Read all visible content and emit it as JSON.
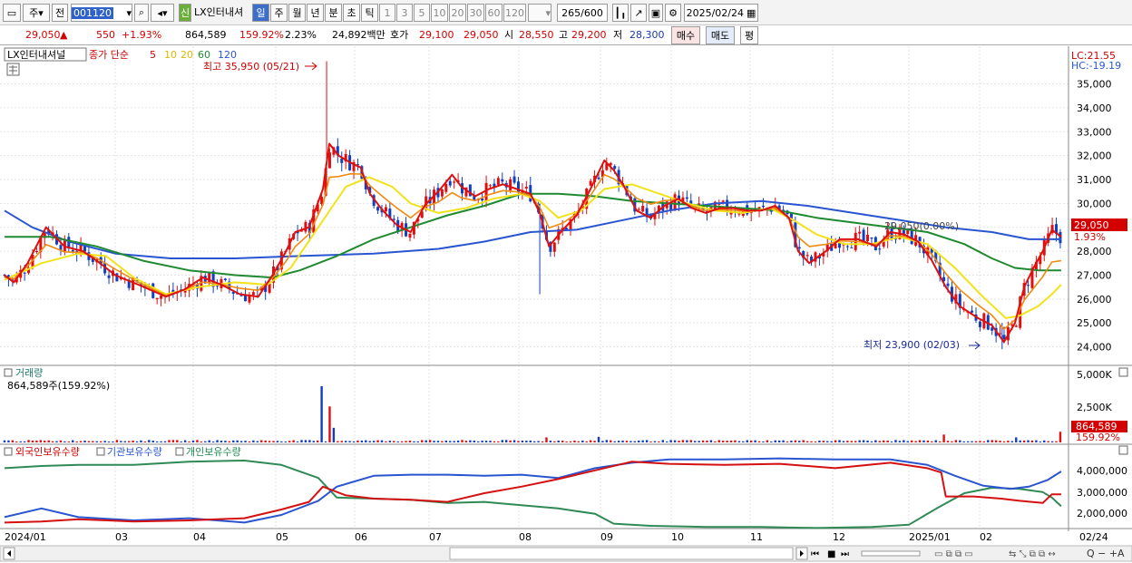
{
  "toolbar": {
    "mode": "주",
    "prev": "전",
    "code": "001120",
    "name": "LX인터내셔",
    "credit_badge": "신",
    "periods": [
      "일",
      "주",
      "월",
      "년",
      "분",
      "초",
      "틱"
    ],
    "numbers": [
      "1",
      "3",
      "5",
      "10",
      "20",
      "30",
      "60",
      "120"
    ],
    "count": "265",
    "count_total": "/600",
    "date": "2025/02/24"
  },
  "quote": {
    "price": "29,050",
    "arrow": "▲",
    "change": "550",
    "pct": "+1.93%",
    "volume": "864,589",
    "vol_ratio": "159.92%",
    "turnover_rate": "2.23%",
    "amount": "24,892백만",
    "ask_label": "호가",
    "ask": "29,100",
    "bid": "29,050",
    "open_label": "시",
    "open": "28,550",
    "high_label": "고",
    "high": "29,200",
    "low_label": "저",
    "low": "28,300",
    "buy": "매수",
    "sell": "매도",
    "avg": "평"
  },
  "legend": {
    "name": "LX인터내셔널",
    "ma_label": "종가 단순",
    "ma5": "5",
    "ma10": "10",
    "ma20": "20",
    "ma60": "60",
    "ma120": "120"
  },
  "annotations": {
    "high": "최고 35,950 (05/21)",
    "low": "최저 23,900 (02/03)",
    "mid": "29,050(0.00%)",
    "lc": "LC:21.55",
    "hc": "HC:-19.19",
    "last_price": "29,050",
    "last_pct": "1.93%"
  },
  "volume_panel": {
    "title": "거래량",
    "value": "864,589주(159.92%)",
    "last": "864,589",
    "last_pct": "159.92%",
    "ticks": [
      "5,000K",
      "2,500K"
    ]
  },
  "holdings_panel": {
    "series": [
      "외국인보유수량",
      "기관보유수량",
      "개인보유수량"
    ],
    "ticks": [
      "4,000,000",
      "3,000,000",
      "2,000,000"
    ]
  },
  "xaxis": [
    "2024/01",
    "03",
    "04",
    "05",
    "06",
    "07",
    "08",
    "09",
    "10",
    "11",
    "12",
    "2025/01",
    "02",
    "02/24"
  ],
  "chart_data": {
    "type": "candlestick",
    "ylim": [
      23300,
      36500
    ],
    "yticks": [
      35000,
      34000,
      33000,
      32000,
      31000,
      30000,
      29000,
      28000,
      27000,
      26000,
      25000,
      24000
    ],
    "high": {
      "value": 35950,
      "date": "05/21"
    },
    "low": {
      "value": 23900,
      "date": "02/03"
    },
    "last": 29050,
    "ma5": [
      [
        0,
        27000
      ],
      [
        10,
        26700
      ],
      [
        25,
        27500
      ],
      [
        45,
        29000
      ],
      [
        65,
        28200
      ],
      [
        85,
        28000
      ],
      [
        100,
        27600
      ],
      [
        120,
        27000
      ],
      [
        145,
        26600
      ],
      [
        175,
        26100
      ],
      [
        195,
        26400
      ],
      [
        215,
        26900
      ],
      [
        235,
        26600
      ],
      [
        255,
        26200
      ],
      [
        275,
        26100
      ],
      [
        292,
        27100
      ],
      [
        305,
        28000
      ],
      [
        315,
        28800
      ],
      [
        330,
        29000
      ],
      [
        345,
        30600
      ],
      [
        352,
        32500
      ],
      [
        362,
        32000
      ],
      [
        375,
        31700
      ],
      [
        386,
        31500
      ],
      [
        396,
        30400
      ],
      [
        410,
        29700
      ],
      [
        425,
        29100
      ],
      [
        440,
        28800
      ],
      [
        455,
        29900
      ],
      [
        470,
        30500
      ],
      [
        485,
        31200
      ],
      [
        495,
        30700
      ],
      [
        510,
        30300
      ],
      [
        525,
        30600
      ],
      [
        540,
        30800
      ],
      [
        555,
        30600
      ],
      [
        570,
        30400
      ],
      [
        580,
        29600
      ],
      [
        590,
        28200
      ],
      [
        605,
        28900
      ],
      [
        620,
        29500
      ],
      [
        635,
        30600
      ],
      [
        650,
        31800
      ],
      [
        660,
        31400
      ],
      [
        670,
        30800
      ],
      [
        685,
        29700
      ],
      [
        700,
        29400
      ],
      [
        715,
        29900
      ],
      [
        730,
        30200
      ],
      [
        745,
        29800
      ],
      [
        760,
        29600
      ],
      [
        775,
        29800
      ],
      [
        790,
        29800
      ],
      [
        805,
        29700
      ],
      [
        820,
        29700
      ],
      [
        835,
        29900
      ],
      [
        850,
        29400
      ],
      [
        860,
        28000
      ],
      [
        872,
        27500
      ],
      [
        890,
        28000
      ],
      [
        905,
        28500
      ],
      [
        925,
        28500
      ],
      [
        945,
        28200
      ],
      [
        960,
        28800
      ],
      [
        975,
        28700
      ],
      [
        990,
        28400
      ],
      [
        1005,
        27600
      ],
      [
        1020,
        26500
      ],
      [
        1035,
        25700
      ],
      [
        1055,
        25200
      ],
      [
        1070,
        24900
      ],
      [
        1083,
        24200
      ],
      [
        1095,
        25000
      ],
      [
        1105,
        26500
      ],
      [
        1115,
        27300
      ],
      [
        1125,
        28000
      ],
      [
        1135,
        28900
      ],
      [
        1145,
        28600
      ]
    ],
    "ma20": [
      [
        0,
        26800
      ],
      [
        40,
        27500
      ],
      [
        80,
        27900
      ],
      [
        110,
        27800
      ],
      [
        140,
        26900
      ],
      [
        175,
        26200
      ],
      [
        210,
        26500
      ],
      [
        250,
        26700
      ],
      [
        285,
        26600
      ],
      [
        310,
        27300
      ],
      [
        340,
        29000
      ],
      [
        370,
        30700
      ],
      [
        395,
        31100
      ],
      [
        420,
        30700
      ],
      [
        440,
        30000
      ],
      [
        470,
        29600
      ],
      [
        500,
        29800
      ],
      [
        530,
        30200
      ],
      [
        560,
        30400
      ],
      [
        580,
        30100
      ],
      [
        600,
        29400
      ],
      [
        625,
        29700
      ],
      [
        650,
        30600
      ],
      [
        680,
        30800
      ],
      [
        710,
        30400
      ],
      [
        740,
        30000
      ],
      [
        770,
        29700
      ],
      [
        800,
        29600
      ],
      [
        830,
        29800
      ],
      [
        855,
        29300
      ],
      [
        880,
        28700
      ],
      [
        910,
        28300
      ],
      [
        940,
        28300
      ],
      [
        970,
        28600
      ],
      [
        1000,
        28300
      ],
      [
        1030,
        27300
      ],
      [
        1060,
        26100
      ],
      [
        1085,
        25200
      ],
      [
        1100,
        25300
      ],
      [
        1120,
        25700
      ],
      [
        1135,
        26200
      ],
      [
        1145,
        26600
      ]
    ],
    "ma60": [
      [
        0,
        28600
      ],
      [
        50,
        28600
      ],
      [
        100,
        28200
      ],
      [
        150,
        27600
      ],
      [
        200,
        27200
      ],
      [
        250,
        27000
      ],
      [
        290,
        26900
      ],
      [
        320,
        27200
      ],
      [
        360,
        27800
      ],
      [
        400,
        28500
      ],
      [
        440,
        29000
      ],
      [
        480,
        29500
      ],
      [
        520,
        29900
      ],
      [
        560,
        30400
      ],
      [
        600,
        30400
      ],
      [
        640,
        30300
      ],
      [
        680,
        30100
      ],
      [
        720,
        30000
      ],
      [
        760,
        29900
      ],
      [
        800,
        29800
      ],
      [
        840,
        29700
      ],
      [
        880,
        29400
      ],
      [
        920,
        29200
      ],
      [
        960,
        29000
      ],
      [
        1000,
        28800
      ],
      [
        1040,
        28300
      ],
      [
        1070,
        27700
      ],
      [
        1095,
        27300
      ],
      [
        1120,
        27200
      ],
      [
        1145,
        27200
      ]
    ],
    "ma120": [
      [
        0,
        29700
      ],
      [
        30,
        29000
      ],
      [
        70,
        28400
      ],
      [
        120,
        27900
      ],
      [
        180,
        27700
      ],
      [
        250,
        27700
      ],
      [
        320,
        27800
      ],
      [
        400,
        27900
      ],
      [
        470,
        28100
      ],
      [
        520,
        28400
      ],
      [
        570,
        28800
      ],
      [
        620,
        28900
      ],
      [
        670,
        29300
      ],
      [
        720,
        29700
      ],
      [
        770,
        30000
      ],
      [
        820,
        30100
      ],
      [
        870,
        29900
      ],
      [
        920,
        29600
      ],
      [
        970,
        29300
      ],
      [
        1020,
        29000
      ],
      [
        1070,
        28800
      ],
      [
        1110,
        28500
      ],
      [
        1145,
        28500
      ]
    ],
    "volume_spikes": [
      [
        344,
        5000
      ],
      [
        351,
        3200
      ],
      [
        357,
        1300
      ],
      [
        586,
        450
      ],
      [
        645,
        500
      ],
      [
        1020,
        700
      ],
      [
        1097,
        450
      ],
      [
        1145,
        950
      ]
    ],
    "holdings_foreign": [
      [
        0,
        1650000
      ],
      [
        40,
        1700000
      ],
      [
        80,
        1800000
      ],
      [
        140,
        1700000
      ],
      [
        200,
        1750000
      ],
      [
        260,
        1850000
      ],
      [
        300,
        2250000
      ],
      [
        330,
        2600000
      ],
      [
        345,
        3300000
      ],
      [
        370,
        2900000
      ],
      [
        400,
        2750000
      ],
      [
        440,
        2700000
      ],
      [
        480,
        2600000
      ],
      [
        520,
        3000000
      ],
      [
        560,
        3300000
      ],
      [
        600,
        3650000
      ],
      [
        640,
        4050000
      ],
      [
        680,
        4450000
      ],
      [
        720,
        4350000
      ],
      [
        780,
        4300000
      ],
      [
        840,
        4350000
      ],
      [
        900,
        4150000
      ],
      [
        960,
        4400000
      ],
      [
        1000,
        4150000
      ],
      [
        1015,
        3950000
      ],
      [
        1020,
        2850000
      ],
      [
        1050,
        2850000
      ],
      [
        1080,
        2750000
      ],
      [
        1100,
        2650000
      ],
      [
        1125,
        2550000
      ],
      [
        1135,
        2950000
      ],
      [
        1145,
        2950000
      ]
    ],
    "holdings_institution": [
      [
        0,
        1900000
      ],
      [
        40,
        2300000
      ],
      [
        80,
        1900000
      ],
      [
        140,
        1750000
      ],
      [
        200,
        1850000
      ],
      [
        260,
        1650000
      ],
      [
        300,
        2000000
      ],
      [
        340,
        2650000
      ],
      [
        360,
        3300000
      ],
      [
        400,
        3800000
      ],
      [
        440,
        3850000
      ],
      [
        480,
        3850000
      ],
      [
        520,
        3800000
      ],
      [
        560,
        3850000
      ],
      [
        600,
        3700000
      ],
      [
        640,
        4150000
      ],
      [
        680,
        4400000
      ],
      [
        720,
        4550000
      ],
      [
        780,
        4550000
      ],
      [
        840,
        4600000
      ],
      [
        900,
        4550000
      ],
      [
        960,
        4550000
      ],
      [
        1000,
        4300000
      ],
      [
        1030,
        3800000
      ],
      [
        1060,
        3350000
      ],
      [
        1090,
        3200000
      ],
      [
        1110,
        3300000
      ],
      [
        1130,
        3600000
      ],
      [
        1145,
        4000000
      ]
    ],
    "holdings_individual": [
      [
        0,
        4150000
      ],
      [
        40,
        4250000
      ],
      [
        80,
        4300000
      ],
      [
        140,
        4300000
      ],
      [
        200,
        4450000
      ],
      [
        260,
        4500000
      ],
      [
        300,
        4300000
      ],
      [
        340,
        3700000
      ],
      [
        360,
        2800000
      ],
      [
        400,
        2750000
      ],
      [
        440,
        2700000
      ],
      [
        480,
        2550000
      ],
      [
        520,
        2600000
      ],
      [
        560,
        2450000
      ],
      [
        600,
        2300000
      ],
      [
        640,
        2050000
      ],
      [
        660,
        1600000
      ],
      [
        700,
        1500000
      ],
      [
        760,
        1450000
      ],
      [
        820,
        1450000
      ],
      [
        880,
        1400000
      ],
      [
        940,
        1450000
      ],
      [
        980,
        1550000
      ],
      [
        1010,
        2300000
      ],
      [
        1040,
        3000000
      ],
      [
        1070,
        3250000
      ],
      [
        1100,
        3200000
      ],
      [
        1125,
        3050000
      ],
      [
        1135,
        2800000
      ],
      [
        1145,
        2400000
      ]
    ]
  }
}
